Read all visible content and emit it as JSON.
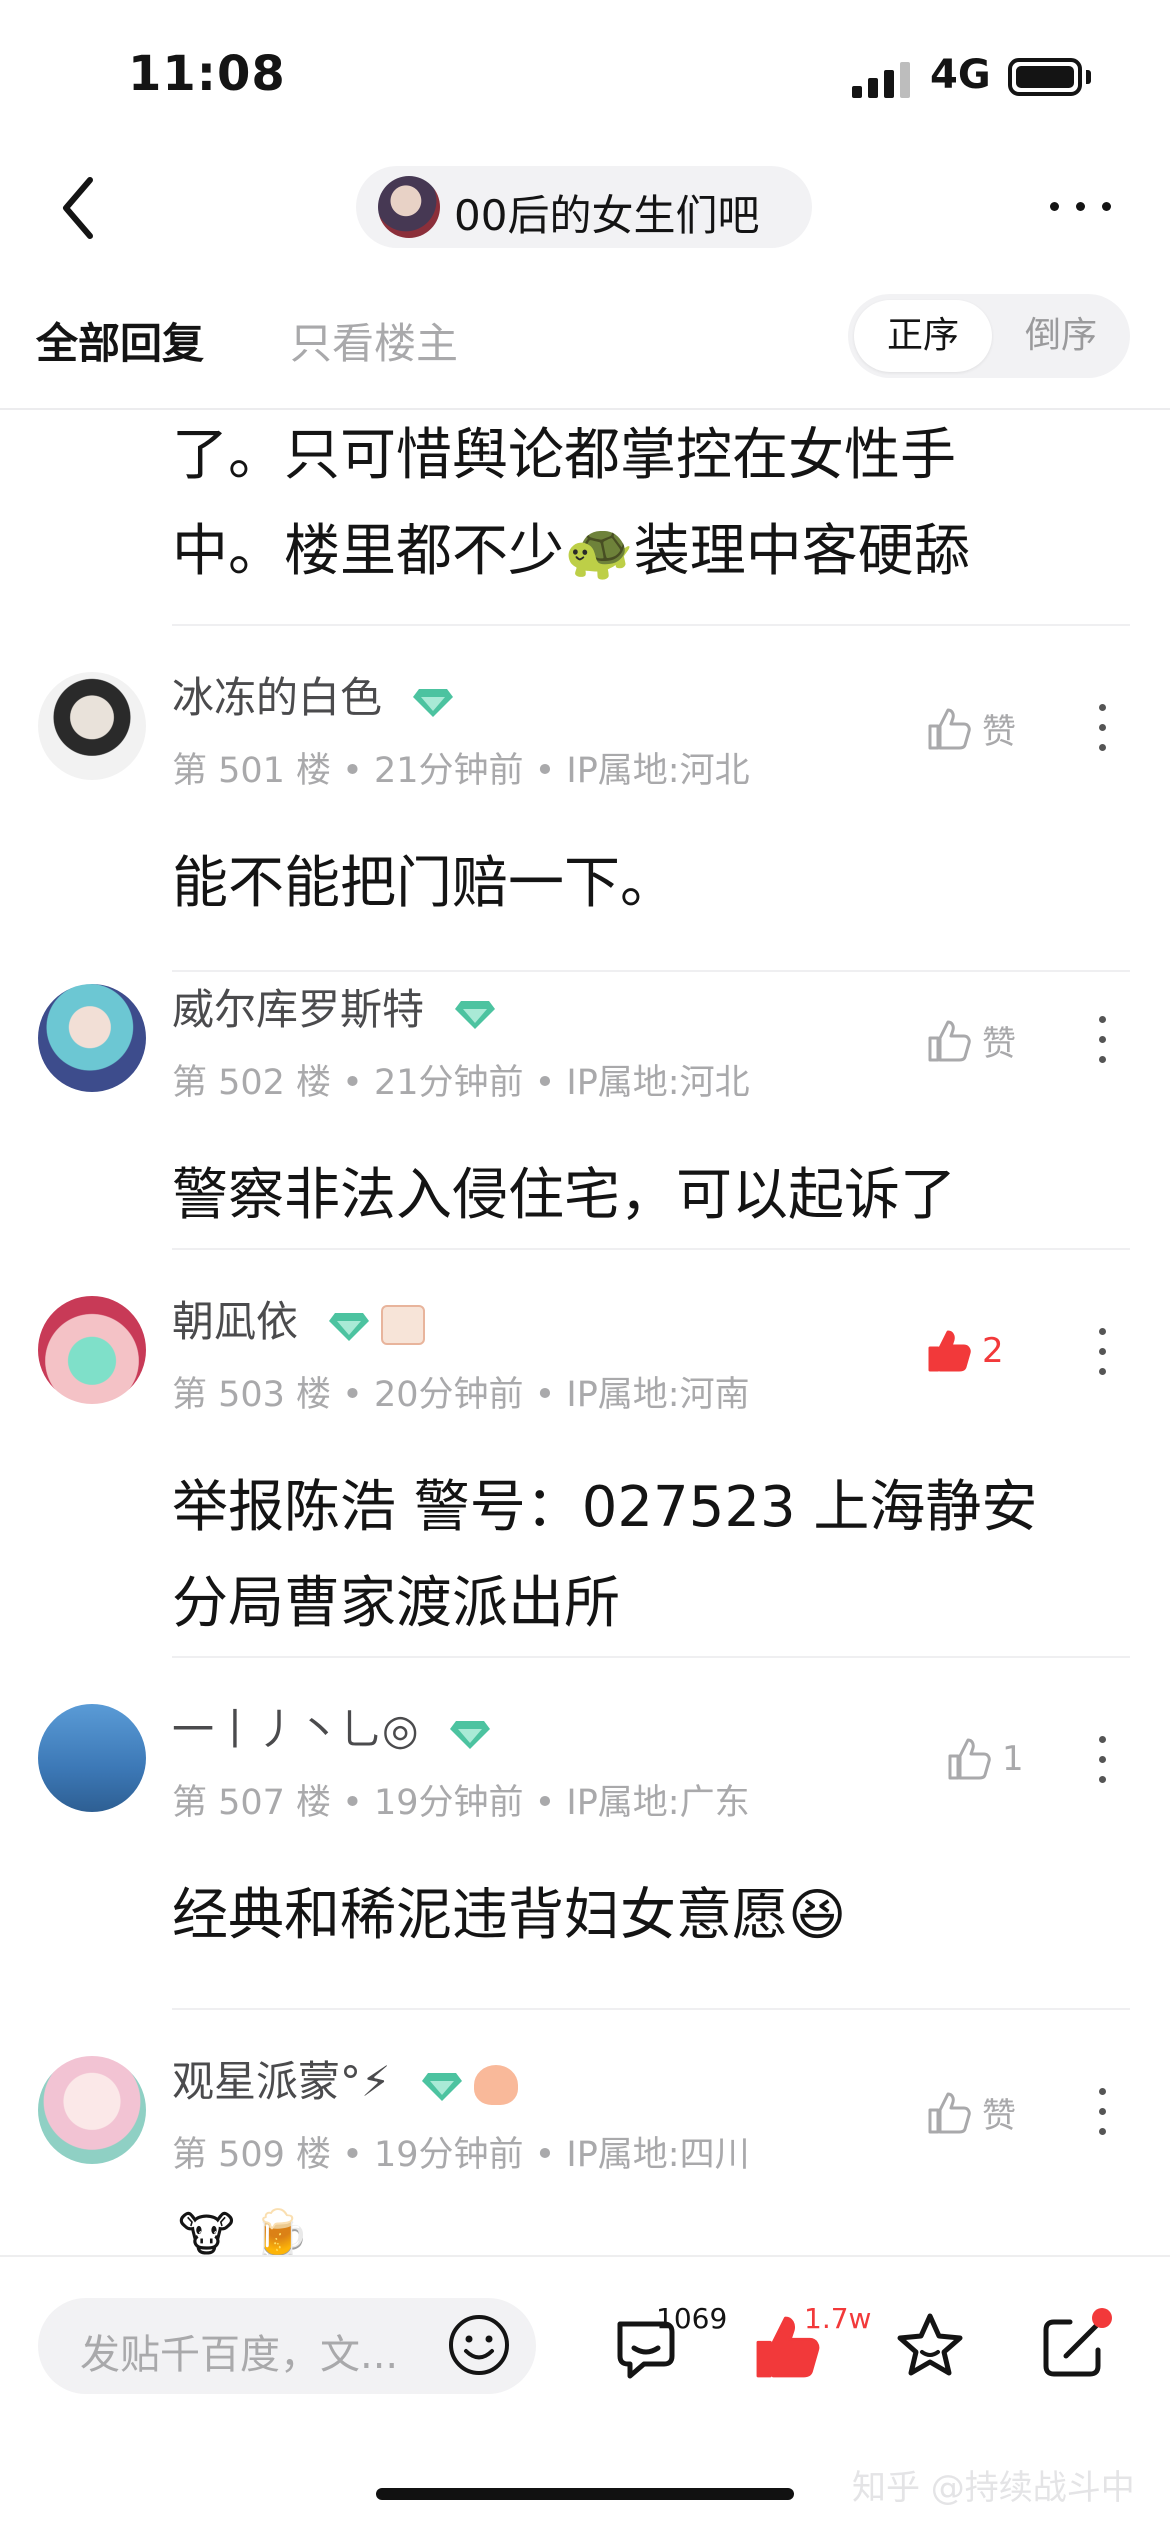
{
  "status_bar": {
    "time": "11:08",
    "network": "4G"
  },
  "nav": {
    "forum_name": "00后的女生们吧"
  },
  "tabs": {
    "all_replies": "全部回复",
    "op_only": "只看楼主",
    "order_asc": "正序",
    "order_desc": "倒序"
  },
  "continuation": {
    "lines": [
      "了。只可惜舆论都掌控在女性手",
      "中。楼里都不少🐢装理中客硬舔"
    ]
  },
  "posts": [
    {
      "username": "冰冻的白色",
      "meta": "第 501 楼 • 21分钟前 • IP属地:河北",
      "body": [
        "能不能把门赔一下。"
      ],
      "like_label": "赞",
      "liked": false
    },
    {
      "username": "威尔库罗斯特",
      "meta": "第 502 楼 • 21分钟前 • IP属地:河北",
      "body": [
        "警察非法入侵住宅，可以起诉了"
      ],
      "like_label": "赞",
      "liked": false
    },
    {
      "username": "朝凪依",
      "meta": "第 503 楼 • 20分钟前 • IP属地:河南",
      "body": [
        "举报陈浩 警号：027523 上海静安",
        "分局曹家渡派出所"
      ],
      "like_label": "2",
      "liked": true
    },
    {
      "username": "一丨丿丶乚◎",
      "meta": "第 507 楼 • 19分钟前 • IP属地:广东",
      "body": [
        "经典和稀泥违背妇女意愿😆"
      ],
      "like_label": "1",
      "liked": false
    },
    {
      "username": "观星派蒙°⚡",
      "meta": "第 509 楼 • 19分钟前 • IP属地:四川",
      "body": [
        "🐮 🍺"
      ],
      "like_label": "赞",
      "liked": false
    }
  ],
  "bottom_bar": {
    "compose_placeholder": "发贴千百度，文...",
    "comment_count": "1069",
    "like_count": "1.7w"
  },
  "watermark": "知乎 @持续战斗中",
  "colors": {
    "accent_red": "#f2393a",
    "badge_green": "#4cc3a0",
    "text_secondary": "#a9a9ab"
  },
  "icons": [
    "back-icon",
    "more-icon",
    "diamond-badge-icon",
    "thumb-up-icon",
    "kebab-icon",
    "emoji-icon",
    "comment-icon",
    "star-icon",
    "share-icon"
  ]
}
